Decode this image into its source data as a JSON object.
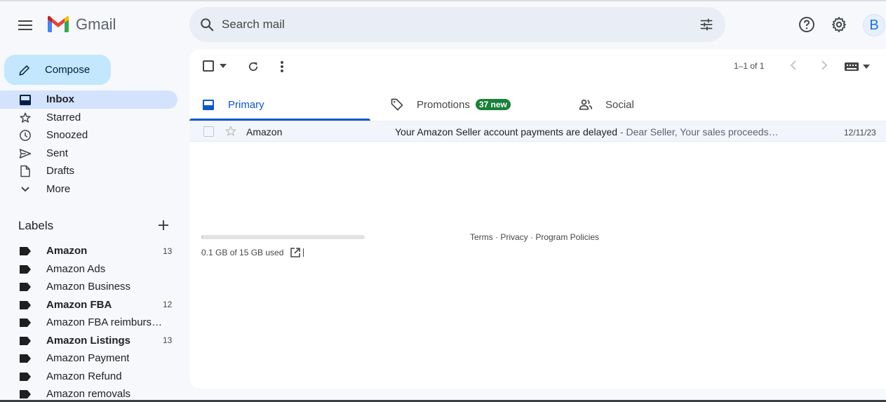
{
  "header": {
    "app_name": "Gmail",
    "search_placeholder": "Search mail",
    "avatar_letter": "B"
  },
  "sidebar": {
    "compose_label": "Compose",
    "nav": [
      {
        "label": "Inbox",
        "icon": "inbox-icon",
        "active": true
      },
      {
        "label": "Starred",
        "icon": "star-icon"
      },
      {
        "label": "Snoozed",
        "icon": "clock-icon"
      },
      {
        "label": "Sent",
        "icon": "send-icon"
      },
      {
        "label": "Drafts",
        "icon": "draft-icon"
      },
      {
        "label": "More",
        "icon": "chevron-down-icon"
      }
    ],
    "labels_title": "Labels",
    "labels": [
      {
        "label": "Amazon",
        "count": "13",
        "bold": true
      },
      {
        "label": "Amazon Ads",
        "count": "",
        "bold": false
      },
      {
        "label": "Amazon Business",
        "count": "",
        "bold": false
      },
      {
        "label": "Amazon FBA",
        "count": "12",
        "bold": true
      },
      {
        "label": "Amazon FBA reimburse…",
        "count": "",
        "bold": false
      },
      {
        "label": "Amazon Listings",
        "count": "13",
        "bold": true
      },
      {
        "label": "Amazon Payment",
        "count": "",
        "bold": false
      },
      {
        "label": "Amazon Refund",
        "count": "",
        "bold": false
      },
      {
        "label": "Amazon removals",
        "count": "",
        "bold": false
      }
    ]
  },
  "toolbar": {
    "pager_text": "1–1 of 1"
  },
  "tabs": [
    {
      "label": "Primary",
      "icon": "inbox-tab-icon",
      "active": true
    },
    {
      "label": "Promotions",
      "icon": "tag-icon",
      "badge": "37 new"
    },
    {
      "label": "Social",
      "icon": "people-icon"
    }
  ],
  "emails": [
    {
      "sender": "Amazon",
      "subject": "Your Amazon Seller account payments are delayed",
      "snippet": " - Dear Seller, Your sales proceeds…",
      "date": "12/11/23"
    }
  ],
  "footer": {
    "storage_text": "0.1 GB of 15 GB used",
    "storage_fraction": 0.007,
    "links": "Terms · Privacy · Program Policies"
  },
  "colors": {
    "accent": "#0b57d0",
    "compose_bg": "#c2e7ff",
    "active_nav_bg": "#d3e3fd",
    "badge_green": "#188038"
  }
}
